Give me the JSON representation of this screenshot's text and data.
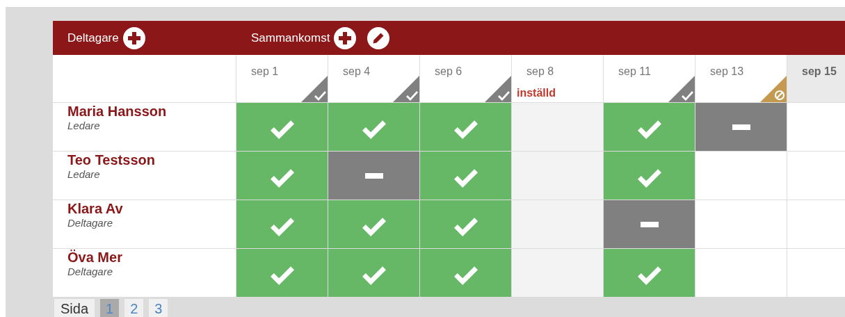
{
  "header": {
    "participants_label": "Deltagare",
    "meetings_label": "Sammankomst"
  },
  "columns": [
    {
      "date": "sep 1",
      "confirmed": true,
      "blocked": false,
      "cancelled": false,
      "highlighted": false
    },
    {
      "date": "sep 4",
      "confirmed": true,
      "blocked": false,
      "cancelled": false,
      "highlighted": false
    },
    {
      "date": "sep 6",
      "confirmed": true,
      "blocked": false,
      "cancelled": false,
      "highlighted": false
    },
    {
      "date": "sep 8",
      "confirmed": false,
      "blocked": false,
      "cancelled": true,
      "note": "inställd",
      "highlighted": false
    },
    {
      "date": "sep 11",
      "confirmed": true,
      "blocked": false,
      "cancelled": false,
      "highlighted": false
    },
    {
      "date": "sep 13",
      "confirmed": false,
      "blocked": true,
      "cancelled": false,
      "highlighted": false
    },
    {
      "date": "sep 15",
      "confirmed": false,
      "blocked": false,
      "cancelled": false,
      "highlighted": true
    }
  ],
  "rows": [
    {
      "name": "Maria Hansson",
      "role": "Ledare",
      "cells": [
        {
          "kind": "present"
        },
        {
          "kind": "present"
        },
        {
          "kind": "present"
        },
        {
          "kind": "empty"
        },
        {
          "kind": "present"
        },
        {
          "kind": "absent"
        },
        {
          "kind": "empty"
        }
      ]
    },
    {
      "name": "Teo Testsson",
      "role": "Ledare",
      "cells": [
        {
          "kind": "present"
        },
        {
          "kind": "absent"
        },
        {
          "kind": "present"
        },
        {
          "kind": "empty"
        },
        {
          "kind": "present"
        },
        {
          "kind": "empty"
        },
        {
          "kind": "empty"
        }
      ]
    },
    {
      "name": "Klara Av",
      "role": "Deltagare",
      "cells": [
        {
          "kind": "present"
        },
        {
          "kind": "present"
        },
        {
          "kind": "present"
        },
        {
          "kind": "empty"
        },
        {
          "kind": "absent"
        },
        {
          "kind": "empty"
        },
        {
          "kind": "empty"
        }
      ]
    },
    {
      "name": "Öva Mer",
      "role": "Deltagare",
      "cells": [
        {
          "kind": "present"
        },
        {
          "kind": "present"
        },
        {
          "kind": "present"
        },
        {
          "kind": "empty"
        },
        {
          "kind": "present"
        },
        {
          "kind": "empty"
        },
        {
          "kind": "empty"
        }
      ]
    }
  ],
  "pagination": {
    "label": "Sida",
    "pages": [
      {
        "label": "1",
        "selected": true
      },
      {
        "label": "2",
        "selected": false
      },
      {
        "label": "3",
        "selected": false
      }
    ]
  }
}
